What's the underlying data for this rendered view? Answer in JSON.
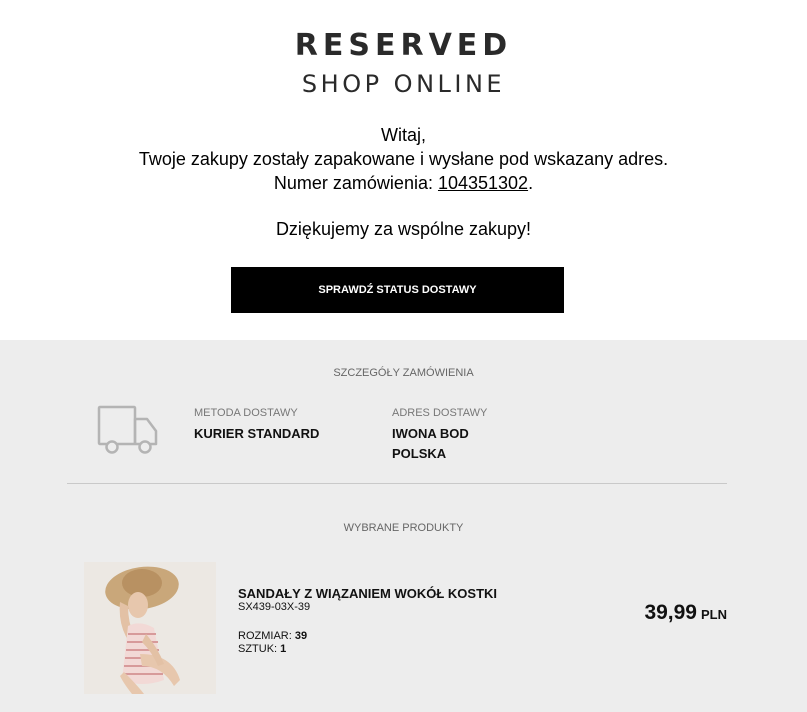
{
  "logo": {
    "brand": "RESERVED",
    "sub": "SHOP ONLINE"
  },
  "message": {
    "greeting": "Witaj,",
    "body": "Twoje zakupy zostały zapakowane i wysłane pod wskazany adres.",
    "order_label": "Numer zamówienia: ",
    "order_number": "104351302",
    "order_suffix": ".",
    "thanks": "Dziękujemy za wspólne zakupy!"
  },
  "cta": {
    "label": "SPRAWDŹ STATUS DOSTAWY"
  },
  "order_details": {
    "title": "SZCZEGÓŁY ZAMÓWIENIA",
    "delivery_method_label": "METODA DOSTAWY",
    "delivery_method_value": "KURIER STANDARD",
    "address_label": "ADRES DOSTAWY",
    "address_name": "IWONA BOD",
    "address_country": "POLSKA",
    "delivery_icon": "truck-icon"
  },
  "products": {
    "title": "WYBRANE PRODUKTY",
    "items": [
      {
        "name": "SANDAŁY Z WIĄZANIEM WOKÓŁ KOSTKI",
        "code": "SX439-03X-39",
        "size_label": "ROZMIAR: ",
        "size": "39",
        "qty_label": "SZTUK: ",
        "qty": "1",
        "price": "39,99",
        "currency": "PLN"
      }
    ]
  },
  "colors": {
    "button_bg": "#000000",
    "details_bg": "#ededed"
  }
}
